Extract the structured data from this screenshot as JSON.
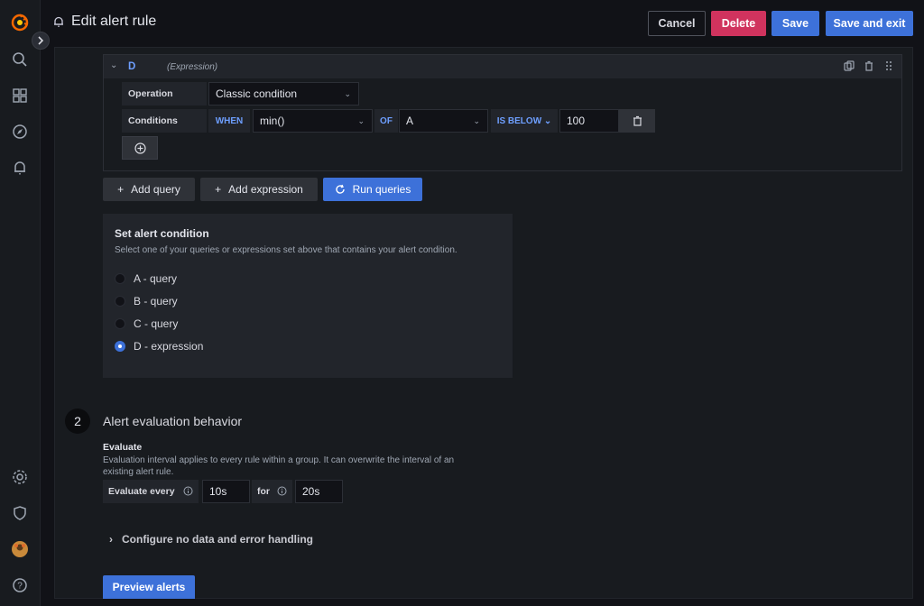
{
  "header": {
    "title": "Edit alert rule",
    "cancel_label": "Cancel",
    "delete_label": "Delete",
    "save_label": "Save",
    "save_exit_label": "Save and exit"
  },
  "sidebar": {
    "items": [
      "grafana-logo",
      "search-icon",
      "dashboards-icon",
      "explore-icon",
      "alerting-icon",
      "settings-icon",
      "shield-icon",
      "avatar",
      "help-icon"
    ]
  },
  "query": {
    "name": "D",
    "type": "(Expression)",
    "operation_label": "Operation",
    "operation_value": "Classic condition",
    "conditions_label": "Conditions",
    "when": "WHEN",
    "func": "min()",
    "of": "OF",
    "of_value": "A",
    "evaluator": "IS BELOW",
    "threshold": "100"
  },
  "actions": {
    "add_query": "Add query",
    "add_expression": "Add expression",
    "run_queries": "Run queries"
  },
  "condition": {
    "title": "Set alert condition",
    "description": "Select one of your queries or expressions set above that contains your alert condition.",
    "options": [
      "A - query",
      "B - query",
      "C - query",
      "D - expression"
    ],
    "selected": "D - expression"
  },
  "evaluation": {
    "step_number": "2",
    "title": "Alert evaluation behavior",
    "evaluate_label": "Evaluate",
    "evaluate_desc": "Evaluation interval applies to every rule within a group. It can overwrite the interval of an existing alert rule.",
    "evaluate_every_label": "Evaluate every",
    "evaluate_every_value": "10s",
    "for_label": "for",
    "for_value": "20s",
    "config_label": "Configure no data and error handling",
    "preview_label": "Preview alerts"
  }
}
